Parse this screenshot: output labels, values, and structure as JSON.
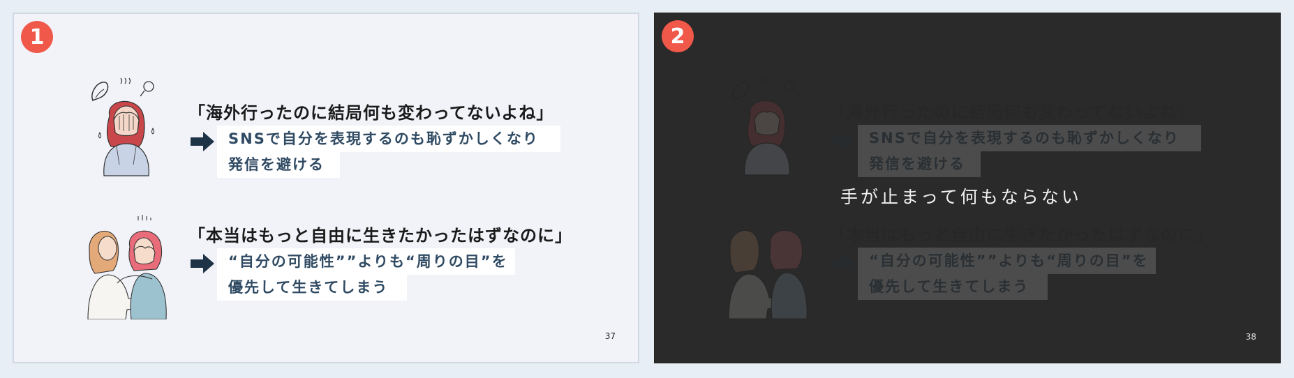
{
  "slides": [
    {
      "badge": "1",
      "quote1": "「海外行ったのに結局何も変わってないよね」",
      "line1a": "SNSで自分を表現するのも恥ずかしくなり",
      "line1b": "発信を避ける",
      "quote2": "「本当はもっと自由に生きたかったはずなのに」",
      "line2a": "“自分の可能性””よりも“周りの目”を",
      "line2b": "優先して生きてしまう",
      "page": "37"
    },
    {
      "badge": "2",
      "quote1": "「海外行ったのに結局何も変わってないよね」",
      "line1a": "SNSで自分を表現するのも恥ずかしくなり",
      "line1b": "発信を避ける",
      "quote2": "「本当はもっと自由に生きたかったはずなのに」",
      "line2a": "“自分の可能性””よりも“周りの目”を",
      "line2b": "優先して生きてしまう",
      "overlay": "手が止まって何もならない",
      "page": "38"
    }
  ],
  "colors": {
    "badge": "#f0584a",
    "highlight_text": "#2f4a63",
    "arrow": "#1f3346",
    "dark_slide": "#2a2a2a"
  },
  "icons": {
    "arrow": "arrow-right-icon",
    "illustration1": "woman-covering-face-illustration",
    "illustration2": "friend-comforting-illustration"
  }
}
